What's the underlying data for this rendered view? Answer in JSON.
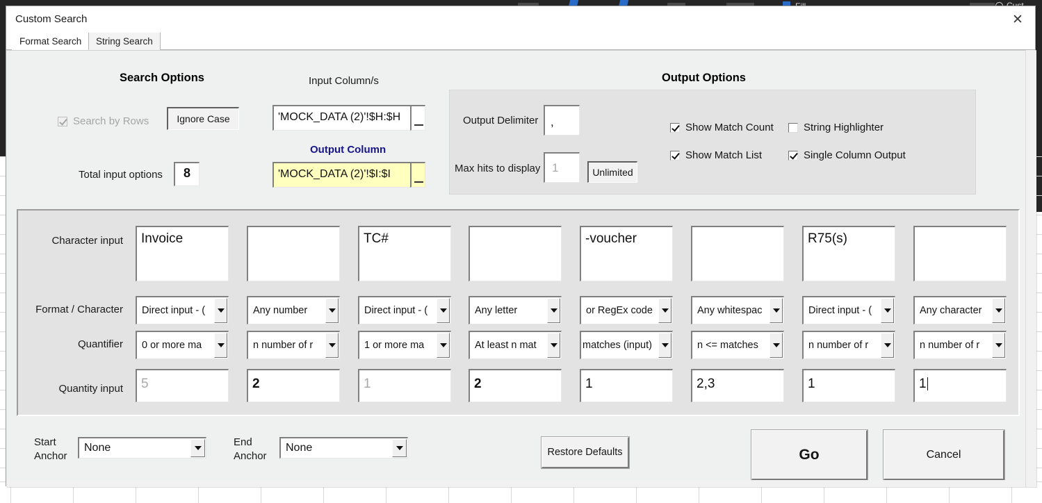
{
  "window": {
    "title": "Custom Search",
    "close_icon": "close-icon"
  },
  "tabs": [
    {
      "label": "Format Search",
      "active": true
    },
    {
      "label": "String Search",
      "active": false
    }
  ],
  "search_options": {
    "heading": "Search Options",
    "search_by_rows": {
      "label": "Search by Rows",
      "checked": true,
      "disabled": true
    },
    "ignore_case_button": "Ignore Case",
    "total_input_options_label": "Total input options",
    "total_input_options_value": "8",
    "input_column_label": "Input Column/s",
    "input_column_value": "'MOCK_DATA (2)'!$H:$H",
    "output_column_label": "Output Column",
    "output_column_value": "'MOCK_DATA (2)'!$I:$I",
    "picker_icon": "range-picker-icon"
  },
  "output_options": {
    "heading": "Output Options",
    "output_delimiter_label": "Output Delimiter",
    "output_delimiter_value": ",",
    "max_hits_label": "Max hits to display",
    "max_hits_value": "1",
    "unlimited_button": "Unlimited",
    "checkboxes": [
      {
        "label": "Show Match Count",
        "checked": true
      },
      {
        "label": "String Highlighter",
        "checked": false
      },
      {
        "label": "Show Match List",
        "checked": true
      },
      {
        "label": "Single Column Output",
        "checked": true
      }
    ]
  },
  "grid": {
    "row_labels": {
      "character_input": "Character input",
      "format_character": "Format / Character",
      "quantifier": "Quantifier",
      "quantity_input": "Quantity input"
    },
    "columns": [
      {
        "character_input": "Invoice",
        "format": "Direct input - (",
        "quantifier": "0 or more ma",
        "quantity": "5",
        "quantity_placeholder": true
      },
      {
        "character_input": "",
        "format": "Any number",
        "quantifier": "n number of r",
        "quantity": "2",
        "quantity_placeholder": false
      },
      {
        "character_input": "TC#",
        "format": "Direct input - (",
        "quantifier": "1 or more ma",
        "quantity": "1",
        "quantity_placeholder": true
      },
      {
        "character_input": "",
        "format": "Any letter",
        "quantifier": "At least n mat",
        "quantity": "2",
        "quantity_placeholder": false
      },
      {
        "character_input": "-voucher",
        "format": "or RegEx code",
        "quantifier": "matches (input)",
        "quantity": "1",
        "quantity_placeholder": false
      },
      {
        "character_input": "",
        "format": "Any whitespac",
        "quantifier": "n <= matches",
        "quantity": "2,3",
        "quantity_placeholder": false
      },
      {
        "character_input": "R75(s)",
        "format": "Direct input - (",
        "quantifier": "n number of r",
        "quantity": "1",
        "quantity_placeholder": false
      },
      {
        "character_input": "",
        "format": "Any character",
        "quantifier": "n number of r",
        "quantity": "1",
        "quantity_placeholder": false,
        "focused": true
      }
    ]
  },
  "footer": {
    "start_anchor_label": "Start\nAnchor",
    "start_anchor_label_line1": "Start",
    "start_anchor_label_line2": "Anchor",
    "start_anchor_value": "None",
    "end_anchor_label_line1": "End",
    "end_anchor_label_line2": "Anchor",
    "end_anchor_value": "None",
    "restore_defaults_button": "Restore Defaults",
    "go_button": "Go",
    "cancel_button": "Cancel"
  },
  "colors": {
    "dialog_bg": "#eff0f0",
    "panel_bg": "#e3e3e3",
    "output_column_highlight": "#ffffbe",
    "output_column_label": "#16168a",
    "ribbon_dark": "#252525"
  }
}
